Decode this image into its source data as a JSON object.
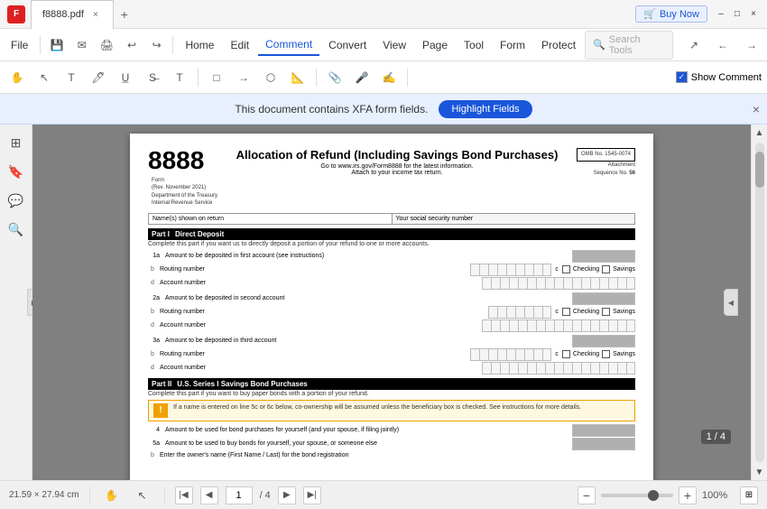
{
  "titlebar": {
    "app_icon": "F",
    "tab_title": "f8888.pdf",
    "close_tab_label": "×",
    "new_tab_label": "+",
    "buy_now_label": "Buy Now",
    "minimize_label": "–",
    "maximize_label": "□",
    "close_label": "×"
  },
  "menubar": {
    "items": [
      {
        "label": "File"
      },
      {
        "label": "Home"
      },
      {
        "label": "Edit"
      },
      {
        "label": "Comment"
      },
      {
        "label": "Convert"
      },
      {
        "label": "View"
      },
      {
        "label": "Page"
      },
      {
        "label": "Tool"
      },
      {
        "label": "Form"
      },
      {
        "label": "Protect"
      }
    ],
    "search_placeholder": "Search Tools",
    "active_item": "Comment"
  },
  "notification": {
    "text": "This document contains XFA form fields.",
    "button_label": "Highlight Fields",
    "close_label": "×"
  },
  "toolbar": {
    "show_comment_label": "Show Comment"
  },
  "pdf": {
    "form_number": "8888",
    "form_meta_line1": "Form",
    "form_meta_line2": "(Rev. November 2021)",
    "form_meta_line3": "Department of the Treasury",
    "form_meta_line4": "Internal Revenue Service",
    "title": "Allocation of Refund (Including Savings Bond Purchases)",
    "subtitle1": "Go to www.irs.gov/Form8888 for the latest information.",
    "subtitle2": "Attach to your income tax return.",
    "omb_label": "OMB No. 1545-0074",
    "attachment_label": "Attachment",
    "sequence_label": "Sequence No.",
    "sequence_no": "56",
    "name_label": "Name(s) shown on return",
    "ssn_label": "Your social security number",
    "part1_label": "Part I",
    "part1_title": "Direct Deposit",
    "part1_desc": "Complete this part if you want us to directly deposit a portion of your refund to one or more accounts.",
    "row1a_label": "Amount to be deposited in first account (see instructions)",
    "row1a_num": "1a",
    "row_b_letter": "b",
    "routing_label": "Routing number",
    "row_c_label": "c",
    "checking_label": "Checking",
    "savings_label": "Savings",
    "row_d_letter": "d",
    "account_label": "Account number",
    "row2a_label": "Amount to be deposited in second account",
    "row2a_num": "2a",
    "row3a_label": "Amount to be deposited in third account",
    "row3a_num": "3a",
    "part2_label": "Part II",
    "part2_title": "U.S. Series I Savings Bond Purchases",
    "part2_desc": "Complete this part if you want to buy paper bonds with a portion of your refund.",
    "warning_text": "If a name is entered on line 5c or 6c below, co-ownership will be assumed unless the beneficiary box is checked. See instructions for more details.",
    "row4_num": "4",
    "row4_label": "Amount to be used for bond purchases for yourself (and your spouse, if filing jointly)",
    "row5a_num": "5a",
    "row5a_label": "Amount to be used to buy bonds for yourself, your spouse, or someone else",
    "row5b_label": "Enter the owner's name (First Name / Last) for the bond registration"
  },
  "bottombar": {
    "page_current": "1",
    "page_total": "/ 4",
    "doc_size": "21.59 × 27.94 cm",
    "zoom_value": "100%",
    "page_counter": "1 / 4"
  }
}
